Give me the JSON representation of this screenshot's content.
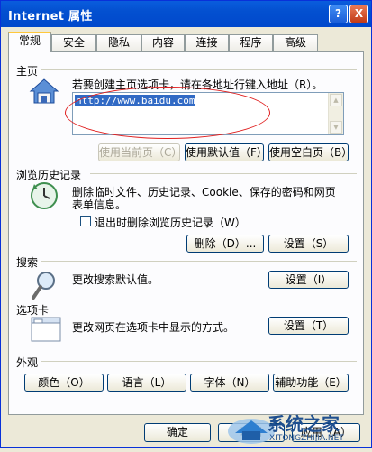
{
  "window": {
    "title": "Internet 属性",
    "help_button": "?",
    "close_button": "X"
  },
  "tabs": [
    "常规",
    "安全",
    "隐私",
    "内容",
    "连接",
    "程序",
    "高级"
  ],
  "home": {
    "heading": "主页",
    "instruction": "若要创建主页选项卡，请在各地址行键入地址（R）。",
    "address_value": "http://www.baidu.com",
    "use_current": "使用当前页（C）",
    "use_default": "使用默认值（F）",
    "use_blank": "使用空白页（B）"
  },
  "history": {
    "heading": "浏览历史记录",
    "line1": "删除临时文件、历史记录、Cookie、保存的密码和网页",
    "line2": "表单信息。",
    "checkbox_label": "退出时删除浏览历史记录（W）",
    "checkbox_checked": false,
    "delete_button": "删除（D）...",
    "settings_button": "设置（S）"
  },
  "search": {
    "heading": "搜索",
    "text": "更改搜索默认值。",
    "settings_button": "设置（I）"
  },
  "tabsec": {
    "heading": "选项卡",
    "text": "更改网页在选项卡中显示的方式。",
    "settings_button": "设置（T）"
  },
  "appearance": {
    "heading": "外观",
    "colors": "颜色（O）",
    "languages": "语言（L）",
    "fonts": "字体（N）",
    "accessibility": "辅助功能（E）"
  },
  "dialog": {
    "ok": "确定",
    "cancel": "取消",
    "apply": "应用（A）"
  },
  "watermark": {
    "text": "系统之家",
    "sub": "XITONGZHIJIA.NET"
  }
}
